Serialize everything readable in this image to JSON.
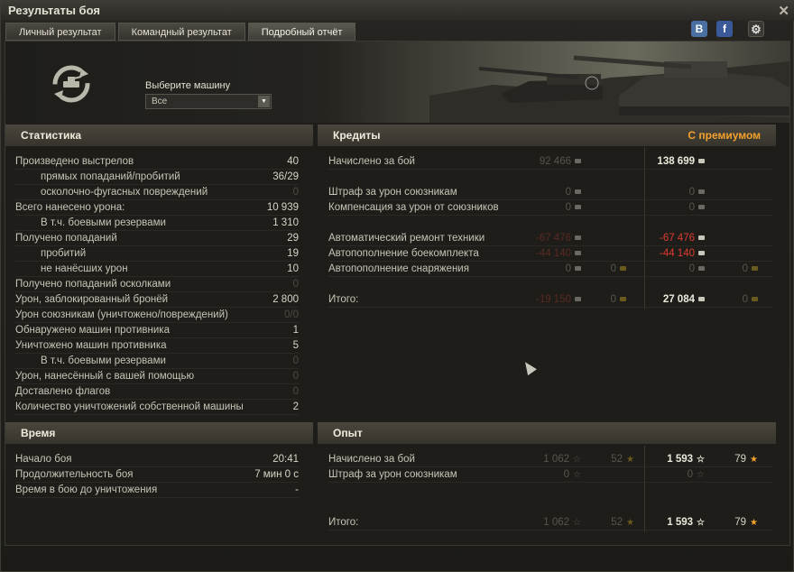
{
  "window": {
    "title": "Результаты боя"
  },
  "tabs": [
    {
      "label": "Личный результат"
    },
    {
      "label": "Командный результат"
    },
    {
      "label": "Подробный отчёт"
    }
  ],
  "social": {
    "vk": "В",
    "fb": "f",
    "gear": "⚙"
  },
  "vehicle_select": {
    "label": "Выберите машину",
    "value": "Все"
  },
  "statistics": {
    "heading": "Статистика",
    "rows": [
      {
        "label": "Произведено выстрелов",
        "value": "40"
      },
      {
        "label": "прямых попаданий/пробитий",
        "value": "36/29"
      },
      {
        "label": "осколочно-фугасных повреждений",
        "value": "0"
      },
      {
        "label": "Всего нанесено урона:",
        "value": "10 939"
      },
      {
        "label": "В т.ч. боевыми резервами",
        "value": "1 310"
      },
      {
        "label": "Получено попаданий",
        "value": "29"
      },
      {
        "label": "пробитий",
        "value": "19"
      },
      {
        "label": "не нанёсших урон",
        "value": "10"
      },
      {
        "label": "Получено попаданий осколками",
        "value": "0"
      },
      {
        "label": "Урон, заблокированный бронёй",
        "value": "2 800"
      },
      {
        "label": "Урон союзникам (уничтожено/повреждений)",
        "value": "0/0"
      },
      {
        "label": "Обнаружено машин противника",
        "value": "1"
      },
      {
        "label": "Уничтожено машин противника",
        "value": "5"
      },
      {
        "label": "В т.ч. боевыми резервами",
        "value": "0"
      },
      {
        "label": "Урон, нанесённый с вашей помощью",
        "value": "0"
      },
      {
        "label": "Доставлено флагов",
        "value": "0"
      },
      {
        "label": "Количество уничтожений собственной машины",
        "value": "2"
      }
    ]
  },
  "time": {
    "heading": "Время",
    "rows": [
      {
        "label": "Начало боя",
        "value": "20:41"
      },
      {
        "label": "Продолжительность боя",
        "value": "7 мин 0 с"
      },
      {
        "label": "Время в бою до уничтожения",
        "value": "-"
      }
    ]
  },
  "credits": {
    "heading": "Кредиты",
    "premium_label": "С премиумом",
    "rows": [
      {
        "label": "Начислено за бой",
        "base": "92 466",
        "gold": "",
        "prem": "138 699",
        "prem_gold": ""
      },
      {
        "label": "Штраф за урон союзникам",
        "base": "0",
        "gold": "",
        "prem": "0",
        "prem_gold": ""
      },
      {
        "label": "Компенсация за урон от союзников",
        "base": "0",
        "gold": "",
        "prem": "0",
        "prem_gold": ""
      },
      {
        "label": "Автоматический ремонт техники",
        "base": "-67 476",
        "gold": "",
        "prem": "-67 476",
        "prem_gold": ""
      },
      {
        "label": "Автопополнение боекомплекта",
        "base": "-44 140",
        "gold": "",
        "prem": "-44 140",
        "prem_gold": ""
      },
      {
        "label": "Автопополнение снаряжения",
        "base": "0",
        "gold": "0",
        "prem": "0",
        "prem_gold": "0"
      },
      {
        "label": "Итого:",
        "base": "-19 150",
        "gold": "0",
        "prem": "27 084",
        "prem_gold": "0"
      }
    ]
  },
  "experience": {
    "heading": "Опыт",
    "rows": [
      {
        "label": "Начислено за бой",
        "base": "1 062",
        "free": "52",
        "prem": "1 593",
        "prem_free": "79"
      },
      {
        "label": "Штраф за урон союзникам",
        "base": "0",
        "free": "",
        "prem": "0",
        "prem_free": ""
      },
      {
        "label": "Итого:",
        "base": "1 062",
        "free": "52",
        "prem": "1 593",
        "prem_free": "79"
      }
    ]
  },
  "colors": {
    "accent": "#f2a12c",
    "negative": "#e03a2e",
    "panel_head": "#4a463c"
  }
}
